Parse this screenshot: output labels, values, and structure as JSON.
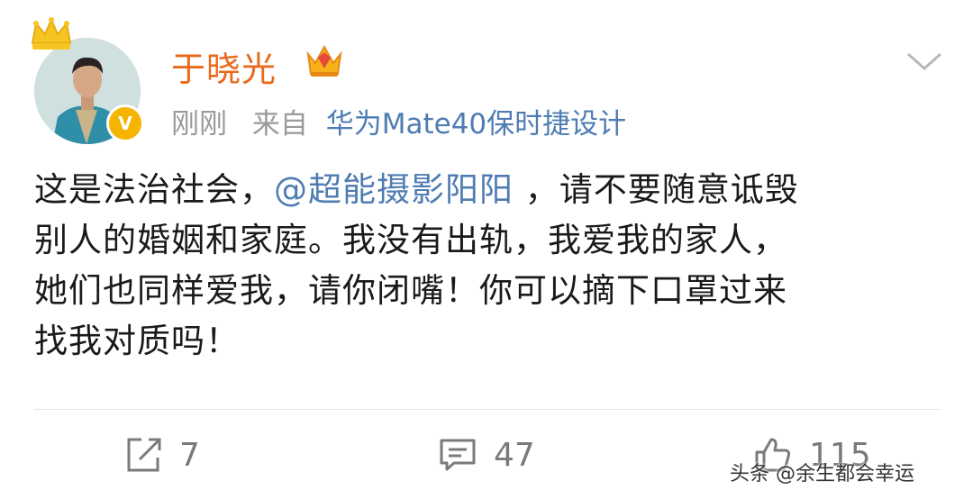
{
  "post": {
    "username": "于晓光",
    "time": "刚刚",
    "from_prefix": "来自",
    "source": "华为Mate40保时捷设计",
    "content": {
      "line1_a": "这是法治社会，",
      "mention": "@超能摄影阳阳",
      "line1_b": " ，请不要随意诋毁",
      "line2": "别人的婚姻和家庭。我没有出轨，我爱我的家人，",
      "line3": "她们也同样爱我，请你闭嘴！你可以摘下口罩过来",
      "line4": "找我对质吗！"
    }
  },
  "actions": {
    "repost_count": "7",
    "comment_count": "47",
    "like_count": "115"
  },
  "watermark": "头条 @余生都会幸运",
  "icons": [
    "crown-icon",
    "verified-icon",
    "vip-crown-icon",
    "chevron-down-icon",
    "repost-icon",
    "comment-icon",
    "like-icon"
  ],
  "colors": {
    "username": "#e86a1c",
    "link": "#4f7cb2",
    "meta": "#9a9a9a",
    "verified_badge": "#f5b400"
  }
}
